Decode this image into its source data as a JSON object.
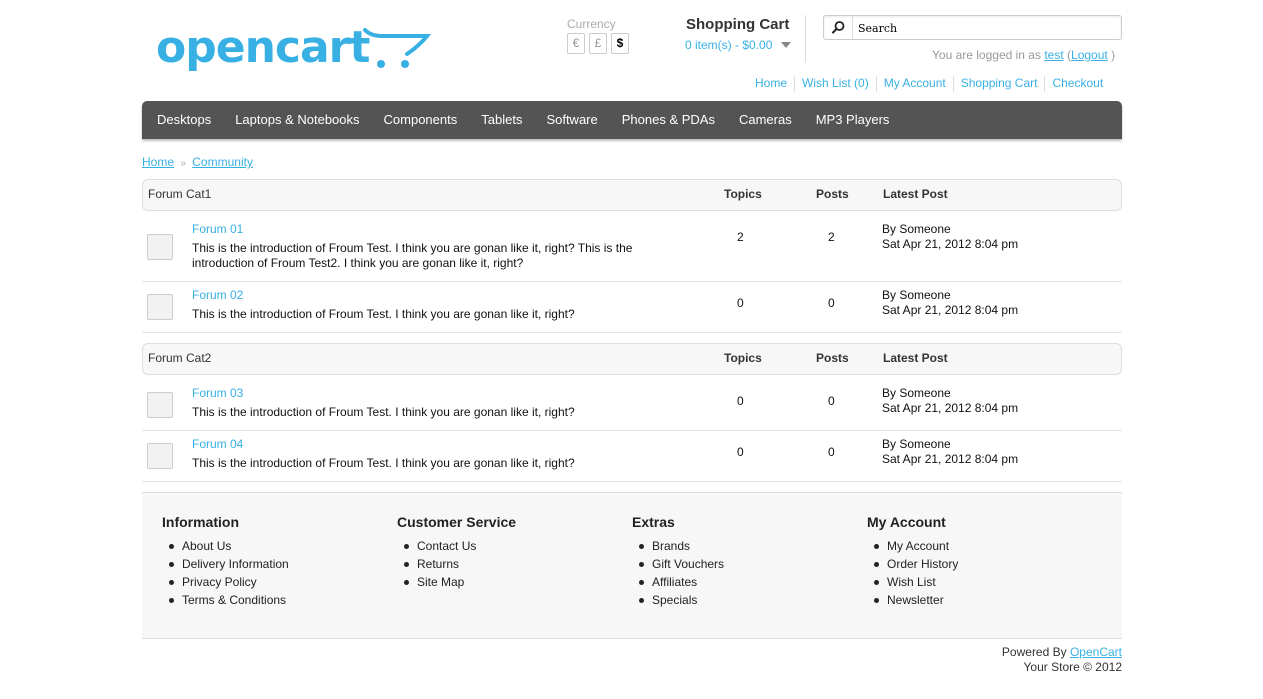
{
  "logo": {
    "text": "opencart"
  },
  "currency": {
    "label": "Currency",
    "options": [
      "€",
      "£",
      "$"
    ],
    "selected": "$"
  },
  "cart": {
    "title": "Shopping Cart",
    "summary": "0 item(s) - $0.00"
  },
  "search": {
    "placeholder": "Search"
  },
  "welcome": {
    "prefix": "You are logged in as",
    "user": "test",
    "open_paren": "(",
    "logout": "Logout",
    "close_paren": ")"
  },
  "toplinks": [
    "Home",
    "Wish List (0)",
    "My Account",
    "Shopping Cart",
    "Checkout"
  ],
  "menu": [
    "Desktops",
    "Laptops & Notebooks",
    "Components",
    "Tablets",
    "Software",
    "Phones & PDAs",
    "Cameras",
    "MP3 Players"
  ],
  "breadcrumb": {
    "items": [
      "Home",
      "Community"
    ],
    "separator": "»"
  },
  "categories": [
    {
      "name": "Forum Cat1",
      "col_topics": "Topics",
      "col_posts": "Posts",
      "col_latest": "Latest Post",
      "forums": [
        {
          "title": "Forum 01",
          "description": "This is the introduction of Froum Test. I think you are gonan like it, right? This is the introduction of Froum Test2. I think you are gonan like it, right?",
          "topics": "2",
          "posts": "2",
          "latest_by": "By Someone",
          "latest_date": "Sat Apr 21, 2012 8:04 pm"
        },
        {
          "title": "Forum 02",
          "description": "This is the introduction of Froum Test. I think you are gonan like it, right?",
          "topics": "0",
          "posts": "0",
          "latest_by": "By Someone",
          "latest_date": "Sat Apr 21, 2012 8:04 pm"
        }
      ]
    },
    {
      "name": "Forum Cat2",
      "col_topics": "Topics",
      "col_posts": "Posts",
      "col_latest": "Latest Post",
      "forums": [
        {
          "title": "Forum 03",
          "description": "This is the introduction of Froum Test. I think you are gonan like it, right?",
          "topics": "0",
          "posts": "0",
          "latest_by": "By Someone",
          "latest_date": "Sat Apr 21, 2012 8:04 pm"
        },
        {
          "title": "Forum 04",
          "description": "This is the introduction of Froum Test. I think you are gonan like it, right?",
          "topics": "0",
          "posts": "0",
          "latest_by": "By Someone",
          "latest_date": "Sat Apr 21, 2012 8:04 pm"
        }
      ]
    }
  ],
  "footer": {
    "columns": [
      {
        "title": "Information",
        "links": [
          "About Us",
          "Delivery Information",
          "Privacy Policy",
          "Terms & Conditions"
        ]
      },
      {
        "title": "Customer Service",
        "links": [
          "Contact Us",
          "Returns",
          "Site Map"
        ]
      },
      {
        "title": "Extras",
        "links": [
          "Brands",
          "Gift Vouchers",
          "Affiliates",
          "Specials"
        ]
      },
      {
        "title": "My Account",
        "links": [
          "My Account",
          "Order History",
          "Wish List",
          "Newsletter"
        ]
      }
    ]
  },
  "powered": {
    "prefix": "Powered By",
    "link": "OpenCart",
    "copyright": "Your Store © 2012"
  },
  "colors": {
    "accent": "#38b0e3",
    "menu_bg": "#545454",
    "footer_bg": "#f7f7f7"
  },
  "icons": {
    "search": "search-icon",
    "cart": "cart-icon",
    "dropdown": "chevron-down-icon",
    "forum": "forum-icon"
  }
}
